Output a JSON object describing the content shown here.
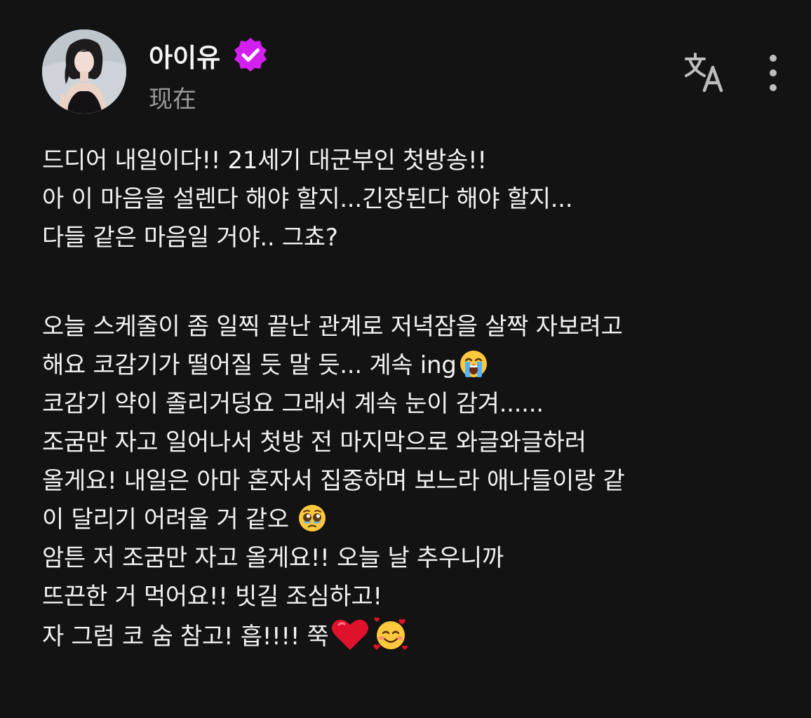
{
  "post": {
    "author": {
      "name": "아이유",
      "verified": true,
      "avatar": "profile-photo",
      "badge_color": "#d31ff0"
    },
    "timestamp": "现在",
    "actions": {
      "translate_icon": "translate-icon",
      "more_icon": "more-vertical-icon"
    },
    "body_lines": [
      "드디어 내일이다!! 21세기 대군부인 첫방송!!",
      "아 이 마음을 설렌다 해야 할지...긴장된다 해야 할지...",
      "다들 같은 마음일 거야.. 그쵸?",
      "",
      "오늘 스케줄이 좀 일찍 끝난 관계로 저녁잠을 살짝 자보려고",
      "해요 코감기가 떨어질 듯 말 듯... 계속 ing",
      "코감기 약이 졸리거덩요 그래서 계속 눈이 감겨......",
      "조굼만 자고 일어나서 첫방 전 마지막으로 와글와글하러",
      "올게요! 내일은 아마 혼자서 집중하며 보느라 애나들이랑 같",
      "이 달리기 어려울 거 같오",
      "암튼 저 조굼만 자고 올게요!! 오늘 날 추우니까",
      "뜨끈한 거 먹어요!! 빗길 조심하고!",
      "자 그럼 코 숨 참고! 흡!!!! 쭉"
    ],
    "emojis": {
      "line_6": "loudly-crying-face-emoji",
      "line_10": "pleading-face-emoji",
      "line_13": [
        "red-heart-emoji",
        "smiling-face-with-hearts-emoji"
      ]
    }
  }
}
